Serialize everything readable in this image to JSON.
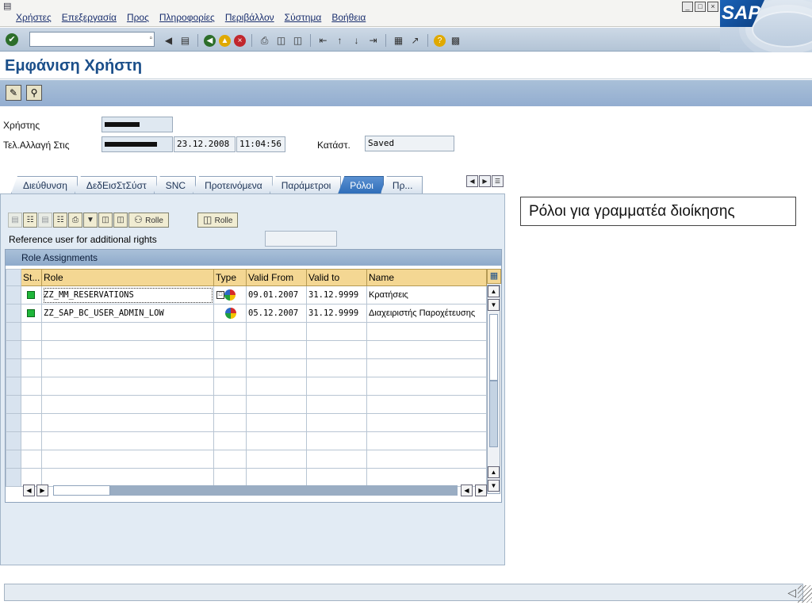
{
  "menu": {
    "items": [
      "Χρήστες",
      "Επεξεργασία",
      "Προς",
      "Πληροφορίες",
      "Περιβάλλον",
      "Σύστημα",
      "Βοήθεια"
    ]
  },
  "window_controls": [
    "minimize",
    "restore",
    "close"
  ],
  "logo": {
    "text": "SAP"
  },
  "toolbar": {
    "command_value": "",
    "icons": [
      "enter-icon",
      "save-icon",
      "back-icon",
      "exit-icon",
      "cancel-icon",
      "print-icon",
      "find-icon",
      "find-next-icon",
      "first-page-icon",
      "previous-page-icon",
      "next-page-icon",
      "last-page-icon",
      "create-session-icon",
      "shortcut-icon",
      "help-icon",
      "layout-menu-icon"
    ]
  },
  "page": {
    "title": "Εμφάνιση Χρήστη"
  },
  "app_toolbar": {
    "icons": [
      "display-change-icon",
      "other-user-icon"
    ]
  },
  "header": {
    "user_label": "Χρήστης",
    "user_value": "",
    "last_changed_label": "Τελ.Αλλαγή Στις",
    "last_changed_by": "",
    "last_changed_date": "23.12.2008",
    "last_changed_time": "11:04:56",
    "status_label": "Κατάστ.",
    "status_value": "Saved"
  },
  "tabs": [
    {
      "label": "Διεύθυνση",
      "active": false
    },
    {
      "label": "ΔεδΕισΣτΣύστ",
      "active": false
    },
    {
      "label": "SNC",
      "active": false
    },
    {
      "label": "Προτεινόμενα",
      "active": false
    },
    {
      "label": "Παράμετροι",
      "active": false
    },
    {
      "label": "Ρόλοι",
      "active": true
    },
    {
      "label": "Πρ...",
      "active": false
    }
  ],
  "panel": {
    "button_rolle_1": "Rolle",
    "button_rolle_2": "Rolle",
    "reference_label": "Reference user for additional rights",
    "reference_value": "",
    "grid_title": "Role Assignments",
    "columns": [
      "St...",
      "Role",
      "Type",
      "Valid From",
      "Valid to",
      "Name"
    ],
    "rows": [
      {
        "status": "green",
        "role": "ZZ_MM_RESERVATIONS",
        "type": "composite",
        "valid_from": "09.01.2007",
        "valid_to": "31.12.9999",
        "name": "Κρατήσεις"
      },
      {
        "status": "green",
        "role": "ZZ_SAP_BC_USER_ADMIN_LOW",
        "type": "single",
        "valid_from": "05.12.2007",
        "valid_to": "31.12.9999",
        "name": "Διαχειριστής Παροχέτευσης"
      }
    ],
    "empty_row_count": 9
  },
  "callout": {
    "text": "Ρόλοι για γραμματέα διοίκησης"
  },
  "statusbar": {
    "text": ""
  },
  "colors": {
    "title": "#1b4f8a",
    "active_tab": "#2f6eb9",
    "grid_header": "#f4d793",
    "status_green": "#1fb63a"
  }
}
